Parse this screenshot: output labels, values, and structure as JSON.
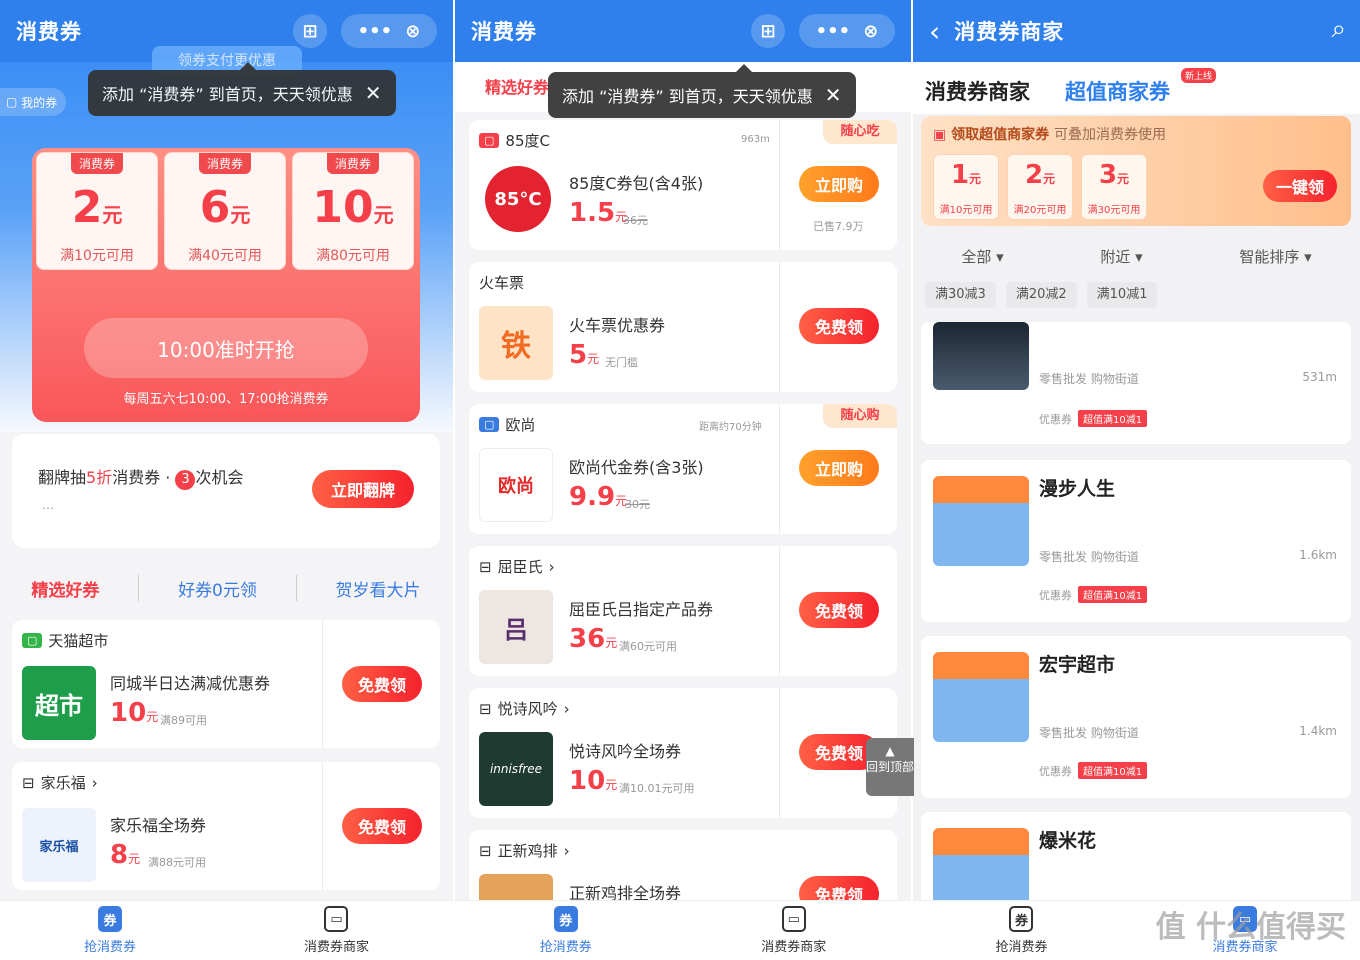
{
  "panel1": {
    "title": "消费券",
    "capsule_dots": "•••",
    "my_coupons": "我的券",
    "pay_tag": "领券支付更优惠",
    "tooltip": "添加 “消费券” 到首页，天天领优惠",
    "coupons": [
      {
        "tag": "消费券",
        "amount": "2",
        "unit": "元",
        "cond": "满10元可用"
      },
      {
        "tag": "消费券",
        "amount": "6",
        "unit": "元",
        "cond": "满40元可用"
      },
      {
        "tag": "消费券",
        "amount": "10",
        "unit": "元",
        "cond": "满80元可用"
      }
    ],
    "start_button": "10:00准时开抢",
    "schedule": "每周五六七10:00、17:00抢消费券",
    "lottery": {
      "text_a": "翻牌抽",
      "text_hl": "5折",
      "text_b": "消费券 · ",
      "chances": "3",
      "text_c": "次机会",
      "sub": "…",
      "button": "立即翻牌"
    },
    "tabs": [
      "精选好券",
      "好券0元领",
      "贺岁看大片"
    ],
    "items": [
      {
        "shop": "天猫超市",
        "name": "同城半日达满减优惠券",
        "price": "10",
        "unit": "元",
        "cond": "满89可用",
        "button": "免费领",
        "thumb": "超市"
      },
      {
        "shop": "家乐福",
        "name": "家乐福全场券",
        "price": "8",
        "unit": "元",
        "cond": "满88元可用",
        "button": "免费领",
        "thumb": "家乐福"
      }
    ]
  },
  "panel2": {
    "title": "消费券",
    "tooltip": "添加 “消费券” 到首页，天天领优惠",
    "tab_active": "精选好券",
    "items": [
      {
        "shop": "85度C",
        "dist": "963m",
        "name": "85度C券包(含4张)",
        "price": "1.5",
        "unit": "元",
        "orig": "36元",
        "button": "立即购",
        "sold": "已售7.9万",
        "badge": "随心吃",
        "thumb": "85°C"
      },
      {
        "shop": "火车票",
        "name": "火车票优惠券",
        "price": "5",
        "unit": "元",
        "orig": "无门槛",
        "button": "免费领",
        "thumb": "铁"
      },
      {
        "shop": "欧尚",
        "dist": "距离约70分钟",
        "name": "欧尚代金券(含3张)",
        "price": "9.9",
        "unit": "元",
        "orig": "30元",
        "button": "立即购",
        "badge": "随心购",
        "thumb": "欧尚"
      },
      {
        "shop": "屈臣氏",
        "name": "屈臣氏吕指定产品券",
        "price": "36",
        "unit": "元",
        "orig": "满60元可用",
        "button": "免费领",
        "thumb": "吕"
      },
      {
        "shop": "悦诗风吟",
        "name": "悦诗风吟全场券",
        "price": "10",
        "unit": "元",
        "orig": "满10.01元可用",
        "button": "免费领",
        "thumb": "innisfree"
      },
      {
        "shop": "正新鸡排",
        "name": "正新鸡排全场券",
        "button": "免费领"
      }
    ],
    "back_top": "回到顶部"
  },
  "panel3": {
    "back": "‹",
    "title": "消费券商家",
    "tab_a": "消费券商家",
    "tab_b": "超值商家券",
    "new_badge": "新上线",
    "banner_title": "领取超值商家券",
    "banner_sub": "可叠加消费券使用",
    "banner_coupons": [
      {
        "amount": "1",
        "unit": "元",
        "cond": "满10元可用"
      },
      {
        "amount": "2",
        "unit": "元",
        "cond": "满20元可用"
      },
      {
        "amount": "3",
        "unit": "元",
        "cond": "满30元可用"
      }
    ],
    "banner_button": "一键领",
    "filters": [
      "全部",
      "附近",
      "智能排序"
    ],
    "chips": [
      "满30减3",
      "满20减2",
      "满10减1"
    ],
    "merchants": [
      {
        "name": "",
        "type": "零售批发 购物街道",
        "dist": "531m",
        "label": "优惠券",
        "tag": "超值满10减1"
      },
      {
        "name": "漫步人生",
        "type": "零售批发 购物街道",
        "dist": "1.6km",
        "label": "优惠券",
        "tag": "超值满10减1"
      },
      {
        "name": "宏宇超市",
        "type": "零售批发 购物街道",
        "dist": "1.4km",
        "label": "优惠券",
        "tag": "超值满10减1"
      },
      {
        "name": "爆米花",
        "type": "",
        "dist": "",
        "label": "",
        "tag": ""
      }
    ]
  },
  "nav": {
    "a": "抢消费券",
    "b": "消费券商家"
  },
  "watermark": "值 什么值得买",
  "colors": {
    "brand": "#2f80ed",
    "accent": "#f5404a"
  }
}
